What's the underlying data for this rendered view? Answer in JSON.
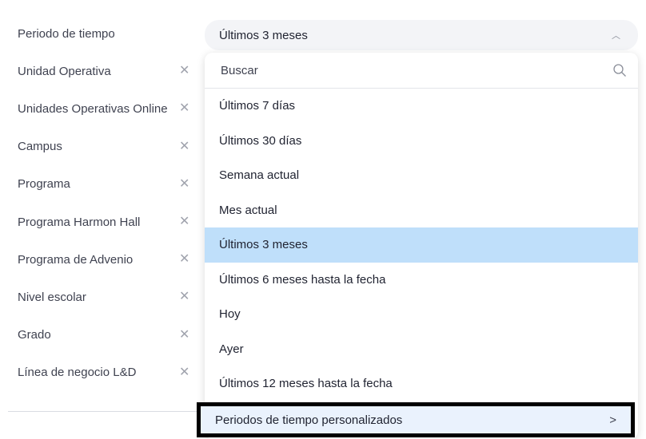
{
  "filters": [
    {
      "label": "Periodo de tiempo",
      "clearable": false
    },
    {
      "label": "Unidad Operativa",
      "clearable": true
    },
    {
      "label": "Unidades Operativas Online",
      "clearable": true
    },
    {
      "label": "Campus",
      "clearable": true
    },
    {
      "label": "Programa",
      "clearable": true
    },
    {
      "label": "Programa Harmon Hall",
      "clearable": true
    },
    {
      "label": "Programa de Advenio",
      "clearable": true
    },
    {
      "label": "Nivel escolar",
      "clearable": true
    },
    {
      "label": "Grado",
      "clearable": true
    },
    {
      "label": "Línea de negocio L&D",
      "clearable": true
    }
  ],
  "clear_glyph": "✕",
  "select": {
    "value": "Últimos 3 meses",
    "chevron": "︿"
  },
  "dropdown": {
    "search_placeholder": "Buscar",
    "options": [
      {
        "label": "Últimos 7 días",
        "selected": false
      },
      {
        "label": "Últimos 30 días",
        "selected": false
      },
      {
        "label": "Semana actual",
        "selected": false
      },
      {
        "label": "Mes actual",
        "selected": false
      },
      {
        "label": "Últimos 3 meses",
        "selected": true
      },
      {
        "label": "Últimos 6 meses hasta la fecha",
        "selected": false
      },
      {
        "label": "Hoy",
        "selected": false
      },
      {
        "label": "Ayer",
        "selected": false
      },
      {
        "label": "Últimos 12 meses hasta la fecha",
        "selected": false
      }
    ],
    "custom_label": "Periodos de tiempo personalizados",
    "custom_arrow": ">"
  },
  "colors": {
    "selected_bg": "#bfdffa",
    "highlight_border": "#000000"
  }
}
